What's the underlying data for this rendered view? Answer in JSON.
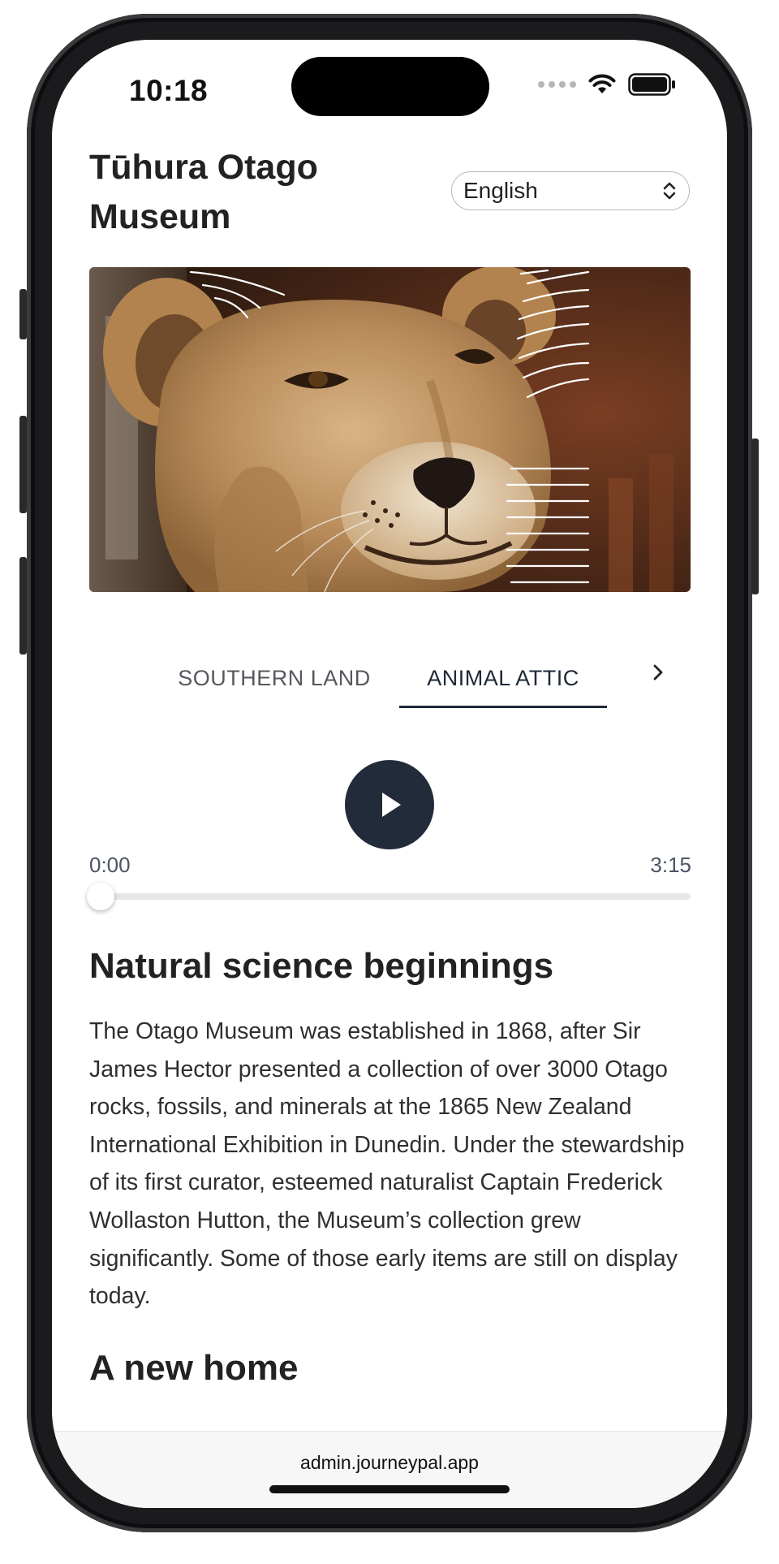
{
  "status_bar": {
    "time": "10:18"
  },
  "header": {
    "title": "Tūhura Otago Museum",
    "language": {
      "selected": "English"
    }
  },
  "hero": {
    "description": "lion-photo-with-tour-markers"
  },
  "tabs": {
    "items": [
      {
        "label": "SOUTHERN LAND",
        "active": false
      },
      {
        "label": "ANIMAL ATTIC",
        "active": true
      }
    ],
    "next_icon": "chevron-right-icon"
  },
  "player": {
    "current_time": "0:00",
    "duration": "3:15",
    "progress": 0,
    "play_icon": "play-icon"
  },
  "article": {
    "heading_1": "Natural science beginnings",
    "paragraph_1": "The Otago Museum was established in 1868, after Sir James Hector presented a collection of over 3000 Otago rocks, fossils, and minerals at the 1865 New Zealand International Exhibition in Dunedin. Under the stewardship of its first curator, esteemed naturalist Captain Frederick Wollaston Hutton, the Museum’s collection grew significantly. Some of those early items are still on display today.",
    "heading_2": "A new home"
  },
  "browser": {
    "url": "admin.journeypal.app"
  },
  "colors": {
    "accent": "#222b3a",
    "text": "#222222",
    "muted": "#55595f"
  }
}
